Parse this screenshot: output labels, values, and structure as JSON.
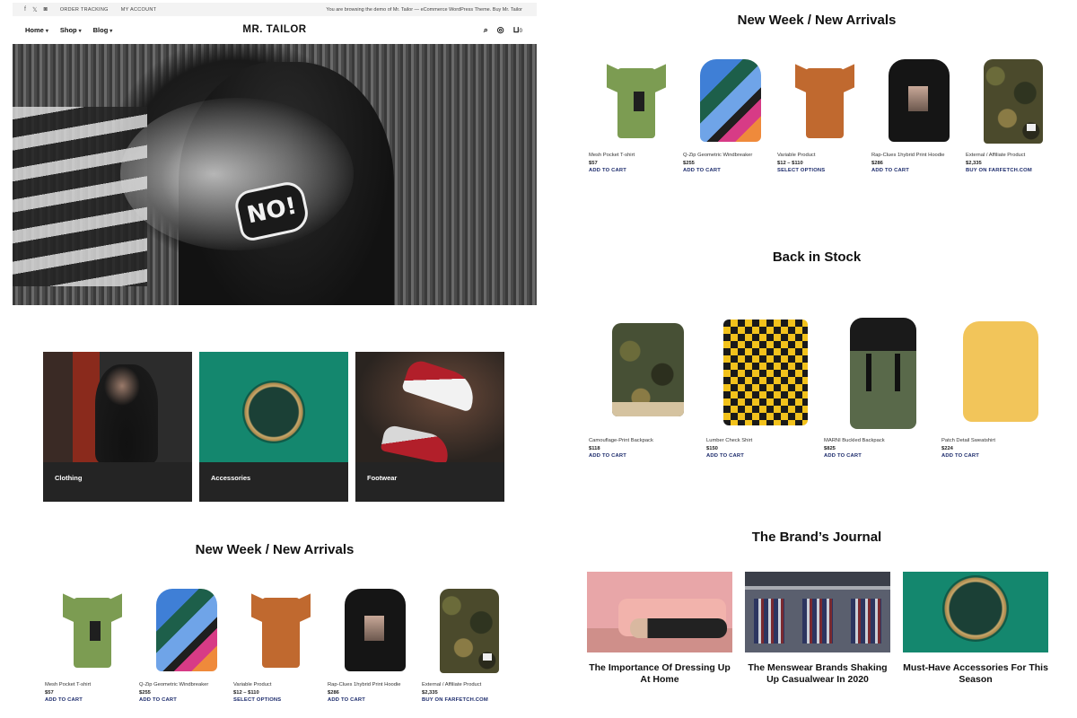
{
  "topbar": {
    "social_icons": [
      "facebook-icon",
      "x-icon",
      "instagram-icon"
    ],
    "links": [
      "ORDER TRACKING",
      "MY ACCOUNT"
    ],
    "demo_text": "You are browsing the demo of Mr. Tailor — eCommerce WordPress Theme. Buy Mr. Tailor"
  },
  "nav": {
    "menu": [
      "Home",
      "Shop",
      "Blog"
    ],
    "logo": "MR. TAILOR",
    "cart_count": "0",
    "icons": [
      "search-icon",
      "account-icon",
      "cart-icon"
    ]
  },
  "hero": {
    "badge_text": "NO!"
  },
  "categories": [
    {
      "label": "Clothing"
    },
    {
      "label": "Accessories"
    },
    {
      "label": "Footwear"
    }
  ],
  "left_arrivals": {
    "title": "New Week / New Arrivals",
    "products": [
      {
        "name": "Mesh Pocket T-shirt",
        "price": "$57",
        "action": "ADD TO CART"
      },
      {
        "name": "Q-Zip Geometric Windbreaker",
        "price": "$255",
        "action": "ADD TO CART"
      },
      {
        "name": "Variable Product",
        "price": "$12 – $110",
        "action": "SELECT OPTIONS"
      },
      {
        "name": "Rap-Clues 1hybrid Print Hoodie",
        "price": "$286",
        "action": "ADD TO CART"
      },
      {
        "name": "External / Affiliate Product",
        "price": "$2,335",
        "action": "BUY ON FARFETCH.COM"
      }
    ]
  },
  "right_arrivals": {
    "title": "New Week / New Arrivals",
    "products": [
      {
        "name": "Mesh Pocket T-shirt",
        "price": "$57",
        "action": "ADD TO CART"
      },
      {
        "name": "Q-Zip Geometric Windbreaker",
        "price": "$255",
        "action": "ADD TO CART"
      },
      {
        "name": "Variable Product",
        "price": "$12 – $110",
        "action": "SELECT OPTIONS"
      },
      {
        "name": "Rap-Clues 1hybrid Print Hoodie",
        "price": "$286",
        "action": "ADD TO CART"
      },
      {
        "name": "External / Affiliate Product",
        "price": "$2,335",
        "action": "BUY ON FARFETCH.COM"
      }
    ]
  },
  "back_in_stock": {
    "title": "Back in Stock",
    "products": [
      {
        "name": "Camouflage-Print Backpack",
        "price": "$118",
        "action": "ADD TO CART"
      },
      {
        "name": "Lumber Check Shirt",
        "price": "$150",
        "action": "ADD TO CART"
      },
      {
        "name": "MARNI Buckled Backpack",
        "price": "$825",
        "action": "ADD TO CART"
      },
      {
        "name": "Patch Detail Sweatshirt",
        "price": "$224",
        "action": "ADD TO CART"
      }
    ]
  },
  "journal": {
    "title": "The Brand’s Journal",
    "posts": [
      {
        "title": "The Importance Of Dressing Up At Home"
      },
      {
        "title": "The Menswear Brands Shaking Up Casualwear In 2020"
      },
      {
        "title": "Must-Have Accessories For This Season"
      }
    ]
  },
  "colors": {
    "accent_link": "#1b2a6b",
    "category_card_bg": "#242424",
    "topbar_bg": "#f3f3f3"
  }
}
